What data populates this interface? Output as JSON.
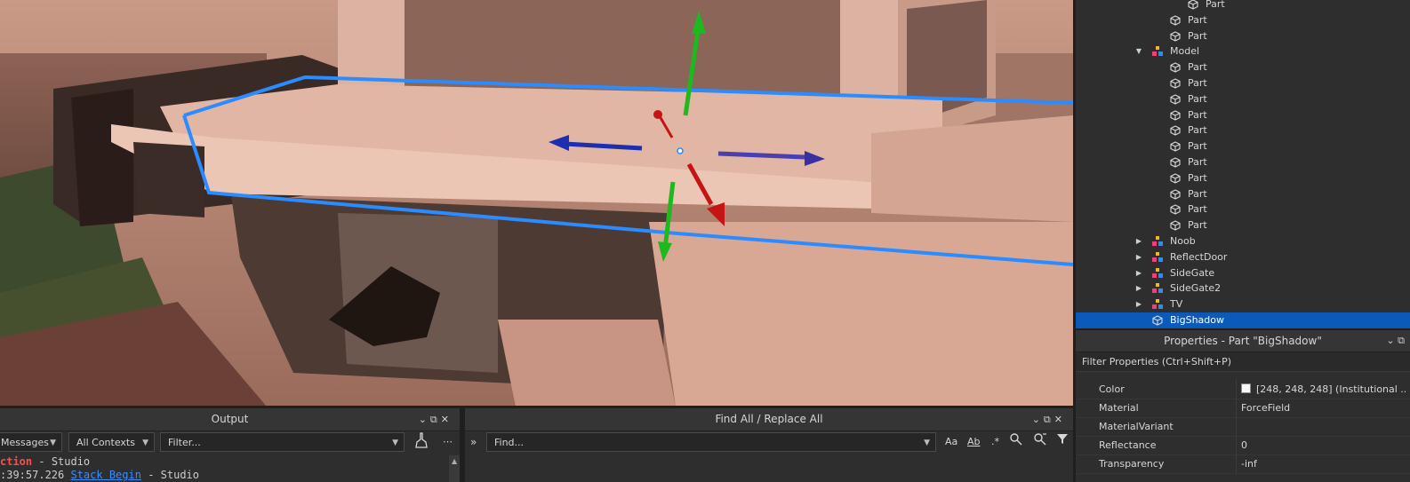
{
  "explorer": {
    "items": [
      {
        "label": "Part",
        "type": "part",
        "indent": 3,
        "arrow": ""
      },
      {
        "label": "Part",
        "type": "part",
        "indent": 2,
        "arrow": ""
      },
      {
        "label": "Part",
        "type": "part",
        "indent": 2,
        "arrow": ""
      },
      {
        "label": "Model",
        "type": "model",
        "indent": 1,
        "arrow": "down"
      },
      {
        "label": "Part",
        "type": "part",
        "indent": 2,
        "arrow": ""
      },
      {
        "label": "Part",
        "type": "part",
        "indent": 2,
        "arrow": ""
      },
      {
        "label": "Part",
        "type": "part",
        "indent": 2,
        "arrow": ""
      },
      {
        "label": "Part",
        "type": "part",
        "indent": 2,
        "arrow": ""
      },
      {
        "label": "Part",
        "type": "part",
        "indent": 2,
        "arrow": ""
      },
      {
        "label": "Part",
        "type": "part",
        "indent": 2,
        "arrow": ""
      },
      {
        "label": "Part",
        "type": "part",
        "indent": 2,
        "arrow": ""
      },
      {
        "label": "Part",
        "type": "part",
        "indent": 2,
        "arrow": ""
      },
      {
        "label": "Part",
        "type": "part",
        "indent": 2,
        "arrow": ""
      },
      {
        "label": "Part",
        "type": "part",
        "indent": 2,
        "arrow": ""
      },
      {
        "label": "Part",
        "type": "part",
        "indent": 2,
        "arrow": ""
      },
      {
        "label": "Noob",
        "type": "model",
        "indent": 1,
        "arrow": "right"
      },
      {
        "label": "ReflectDoor",
        "type": "model",
        "indent": 1,
        "arrow": "right"
      },
      {
        "label": "SideGate",
        "type": "model",
        "indent": 1,
        "arrow": "right"
      },
      {
        "label": "SideGate2",
        "type": "model",
        "indent": 1,
        "arrow": "right"
      },
      {
        "label": "TV",
        "type": "model",
        "indent": 1,
        "arrow": "right"
      },
      {
        "label": "BigShadow",
        "type": "part",
        "indent": 1,
        "arrow": "",
        "selected": true
      }
    ]
  },
  "properties": {
    "title": "Properties - Part \"BigShadow\"",
    "filter_placeholder": "Filter Properties (Ctrl+Shift+P)",
    "rows": [
      {
        "name": "Color",
        "value": "[248, 248, 248] (Institutional ...",
        "swatch": "#f8f8f8"
      },
      {
        "name": "Material",
        "value": "ForceField"
      },
      {
        "name": "MaterialVariant",
        "value": ""
      },
      {
        "name": "Reflectance",
        "value": "0"
      },
      {
        "name": "Transparency",
        "value": "-inf"
      }
    ]
  },
  "output": {
    "title": "Output",
    "messages_filter": "Messages",
    "contexts_filter": "All Contexts",
    "filter_placeholder": "Filter...",
    "log": [
      {
        "text": "ction",
        "sep": "  -  ",
        "source": "Studio",
        "color": "#ff4d4d"
      },
      {
        "text": ":39:57.226",
        "extra": "Stack Begin",
        "sep": "  -  ",
        "source": "Studio",
        "color": "#cccccc"
      }
    ]
  },
  "find": {
    "title": "Find All / Replace All",
    "placeholder": "Find...",
    "match_case": "Aa",
    "whole_word": "Ab",
    "regex": ".*"
  },
  "colors": {
    "selection": "#0b5aba",
    "handle_y": "#1fb81f",
    "handle_x": "#c41414",
    "handle_z": "#1c2fb0",
    "selection_box": "#2a8cff"
  }
}
